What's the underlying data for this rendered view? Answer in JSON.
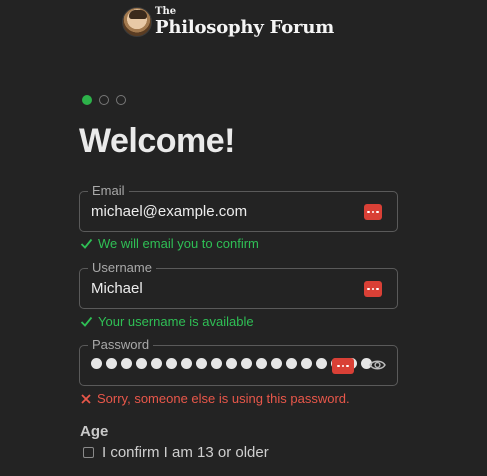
{
  "brand": {
    "small": "The",
    "large": "Philosophy Forum"
  },
  "steps": {
    "total": 3,
    "current": 1
  },
  "title": "Welcome!",
  "email": {
    "legend": "Email",
    "value": "michael@example.com",
    "message": "We will email you to confirm"
  },
  "username": {
    "legend": "Username",
    "value": "Michael",
    "message": "Your username is available"
  },
  "password": {
    "legend": "Password",
    "masked_length": 19,
    "message": "Sorry, someone else is using this password."
  },
  "age": {
    "label": "Age",
    "confirm_label": "I confirm I am 13 or older",
    "checked": false
  },
  "colors": {
    "background": "#232323",
    "success": "#2fbf55",
    "error": "#e8574a",
    "password_manager": "#d94036"
  },
  "icons": [
    "avatar-logo",
    "password-manager-icon",
    "check-icon",
    "cross-icon",
    "eye-icon"
  ]
}
